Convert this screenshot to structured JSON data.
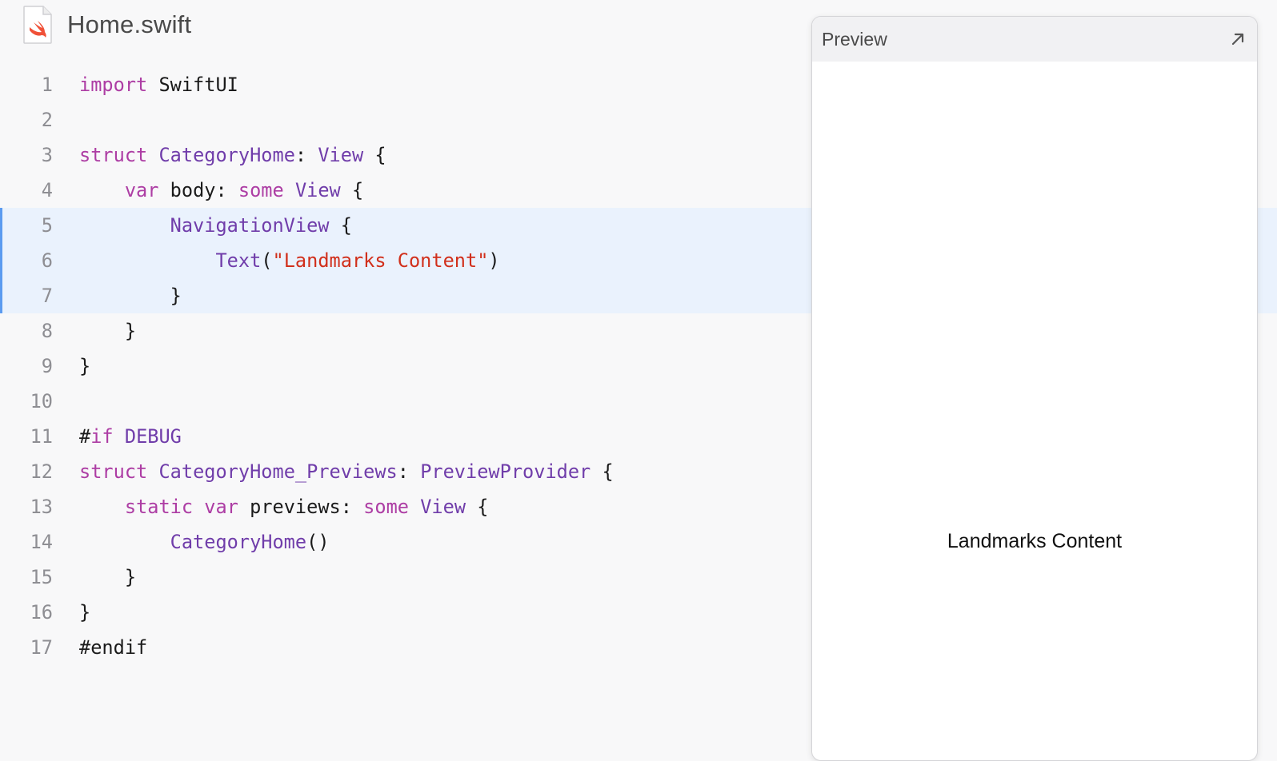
{
  "file": {
    "name": "Home.swift",
    "icon": "swift-file-icon"
  },
  "editor": {
    "highlighted_lines": [
      5,
      6,
      7
    ],
    "lines": [
      {
        "number": "1",
        "segments": [
          {
            "t": "import",
            "c": "k"
          },
          {
            "t": " SwiftUI",
            "c": "p"
          }
        ]
      },
      {
        "number": "2",
        "segments": []
      },
      {
        "number": "3",
        "segments": [
          {
            "t": "struct",
            "c": "k"
          },
          {
            "t": " ",
            "c": "p"
          },
          {
            "t": "CategoryHome",
            "c": "t"
          },
          {
            "t": ": ",
            "c": "p"
          },
          {
            "t": "View",
            "c": "t"
          },
          {
            "t": " {",
            "c": "p"
          }
        ]
      },
      {
        "number": "4",
        "segments": [
          {
            "t": "    ",
            "c": "p"
          },
          {
            "t": "var",
            "c": "k"
          },
          {
            "t": " body: ",
            "c": "p"
          },
          {
            "t": "some",
            "c": "k"
          },
          {
            "t": " ",
            "c": "p"
          },
          {
            "t": "View",
            "c": "t"
          },
          {
            "t": " {",
            "c": "p"
          }
        ]
      },
      {
        "number": "5",
        "segments": [
          {
            "t": "        ",
            "c": "p"
          },
          {
            "t": "NavigationView",
            "c": "t"
          },
          {
            "t": " {",
            "c": "p"
          }
        ]
      },
      {
        "number": "6",
        "segments": [
          {
            "t": "            ",
            "c": "p"
          },
          {
            "t": "Text",
            "c": "t"
          },
          {
            "t": "(",
            "c": "p"
          },
          {
            "t": "\"Landmarks Content\"",
            "c": "s"
          },
          {
            "t": ")",
            "c": "p"
          }
        ]
      },
      {
        "number": "7",
        "segments": [
          {
            "t": "        }",
            "c": "p"
          }
        ]
      },
      {
        "number": "8",
        "segments": [
          {
            "t": "    }",
            "c": "p"
          }
        ]
      },
      {
        "number": "9",
        "segments": [
          {
            "t": "}",
            "c": "p"
          }
        ]
      },
      {
        "number": "10",
        "segments": []
      },
      {
        "number": "11",
        "segments": [
          {
            "t": "#",
            "c": "p"
          },
          {
            "t": "if",
            "c": "k"
          },
          {
            "t": " ",
            "c": "p"
          },
          {
            "t": "DEBUG",
            "c": "t"
          }
        ]
      },
      {
        "number": "12",
        "segments": [
          {
            "t": "struct",
            "c": "k"
          },
          {
            "t": " ",
            "c": "p"
          },
          {
            "t": "CategoryHome_Previews",
            "c": "t"
          },
          {
            "t": ": ",
            "c": "p"
          },
          {
            "t": "PreviewProvider",
            "c": "t"
          },
          {
            "t": " {",
            "c": "p"
          }
        ]
      },
      {
        "number": "13",
        "segments": [
          {
            "t": "    ",
            "c": "p"
          },
          {
            "t": "static",
            "c": "k"
          },
          {
            "t": " ",
            "c": "p"
          },
          {
            "t": "var",
            "c": "k"
          },
          {
            "t": " previews: ",
            "c": "p"
          },
          {
            "t": "some",
            "c": "k"
          },
          {
            "t": " ",
            "c": "p"
          },
          {
            "t": "View",
            "c": "t"
          },
          {
            "t": " {",
            "c": "p"
          }
        ]
      },
      {
        "number": "14",
        "segments": [
          {
            "t": "        ",
            "c": "p"
          },
          {
            "t": "CategoryHome",
            "c": "t"
          },
          {
            "t": "()",
            "c": "p"
          }
        ]
      },
      {
        "number": "15",
        "segments": [
          {
            "t": "    }",
            "c": "p"
          }
        ]
      },
      {
        "number": "16",
        "segments": [
          {
            "t": "}",
            "c": "p"
          }
        ]
      },
      {
        "number": "17",
        "segments": [
          {
            "t": "#endif",
            "c": "p"
          }
        ]
      }
    ]
  },
  "preview": {
    "title": "Preview",
    "expand_icon": "expand-arrow-icon",
    "content_text": "Landmarks Content"
  },
  "colors": {
    "keyword": "#ad3da4",
    "type": "#703daa",
    "string": "#d12f1b",
    "highlight": "#eaf2fd",
    "highlight_bar": "#5b9bf0"
  }
}
